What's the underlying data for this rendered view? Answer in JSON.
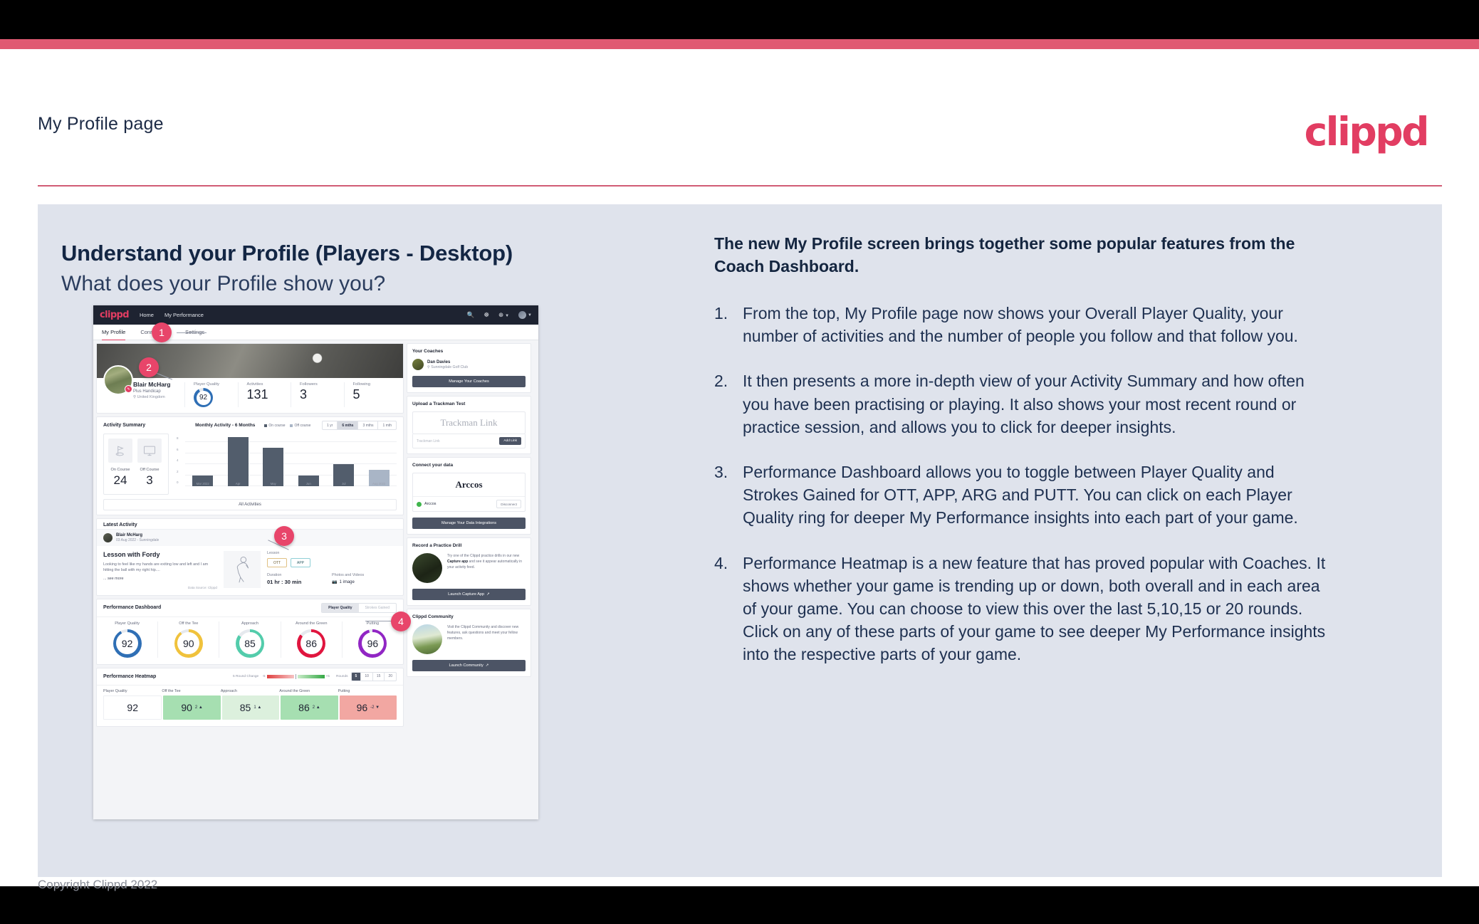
{
  "slide": {
    "header_title": "My Profile page",
    "brand_logo": "clippd",
    "heading_main": "Understand your Profile (Players - Desktop)",
    "heading_sub": "What does your Profile show you?",
    "footer": "Copyright Clippd 2022",
    "accent_pink": "#e23d62",
    "panel_bg": "#dfe3ec"
  },
  "text_column": {
    "lead": "The new My Profile screen brings together some popular features from the Coach Dashboard.",
    "items": [
      {
        "num": "1.",
        "text": "From the top, My Profile page now shows your Overall Player Quality, your number of activities and the number of people you follow and that follow you."
      },
      {
        "num": "2.",
        "text": "It then presents a more in-depth view of your Activity Summary and how often you have been practising or playing. It also shows your most recent round or practice session, and allows you to click for deeper insights."
      },
      {
        "num": "3.",
        "text": "Performance Dashboard allows you to toggle between Player Quality and Strokes Gained for OTT, APP, ARG and PUTT. You can click on each Player Quality ring for deeper My Performance insights into each part of your game."
      },
      {
        "num": "4.",
        "text": "Performance Heatmap is a new feature that has proved popular with Coaches. It shows whether your game is trending up or down, both overall and in each area of your game. You can choose to view this over the last 5,10,15 or 20 rounds. Click on any of these parts of your game to see deeper My Performance insights into the respective parts of your game."
      }
    ]
  },
  "callouts": [
    {
      "num": "1"
    },
    {
      "num": "2"
    },
    {
      "num": "3"
    },
    {
      "num": "4"
    }
  ],
  "app": {
    "nav": {
      "logo": "clippd",
      "links": [
        "Home",
        "My Performance"
      ],
      "icons": [
        "search-icon",
        "community-icon",
        "add-circle-icon",
        "avatar-icon"
      ]
    },
    "tabs": [
      {
        "label": "My Profile",
        "active": true
      },
      {
        "label": "Connections",
        "active": false
      },
      {
        "label": "Settings",
        "active": false
      }
    ],
    "profile": {
      "name": "Blair McHarg",
      "handicap": "Plus Handicap",
      "location": "United Kingdom",
      "stats": [
        {
          "label": "Player Quality",
          "value": "92",
          "type": "ring",
          "color": "#2f6fb5"
        },
        {
          "label": "Activities",
          "value": "131",
          "type": "number"
        },
        {
          "label": "Followers",
          "value": "3",
          "type": "number"
        },
        {
          "label": "Following",
          "value": "5",
          "type": "number"
        }
      ]
    },
    "activity_summary": {
      "title": "Activity Summary",
      "chart_title": "Monthly Activity - 6 Months",
      "legend": [
        {
          "label": "On course",
          "color": "#525d6c"
        },
        {
          "label": "Off course",
          "color": "#a9b5c6"
        }
      ],
      "ranges": [
        {
          "label": "1 yr",
          "active": false
        },
        {
          "label": "6 mths",
          "active": true
        },
        {
          "label": "3 mths",
          "active": false
        },
        {
          "label": "1 mth",
          "active": false
        }
      ],
      "counters": [
        {
          "label": "On Course",
          "value": "24",
          "icon": "golf-flag-icon"
        },
        {
          "label": "Off Course",
          "value": "3",
          "icon": "monitor-icon"
        }
      ],
      "all_activities": "All Activities"
    },
    "latest_activity": {
      "section_title": "Latest Activity",
      "user": "Blair McHarg",
      "date": "03 Aug 2022 - Sunningdale",
      "title": "Lesson with Fordy",
      "description": "Looking to feel like my hands are exiting low and left and I am hitting the ball with my right hip....",
      "see_more": "... see more",
      "source": "Data Source: Clippd",
      "type_label": "Lesson",
      "tags": [
        "OTT",
        "APP"
      ],
      "duration_label": "Duration",
      "duration_value": "01 hr : 30 min",
      "media_label": "Photos and Videos",
      "media_value": "1 image"
    },
    "performance_dashboard": {
      "title": "Performance Dashboard",
      "toggle": [
        {
          "label": "Player Quality",
          "active": true
        },
        {
          "label": "Strokes Gained",
          "active": false
        }
      ],
      "rings": [
        {
          "label": "Player Quality",
          "value": "92",
          "color": "#2f6fb5"
        },
        {
          "label": "Off the Tee",
          "value": "90",
          "color": "#f0c23c"
        },
        {
          "label": "Approach",
          "value": "85",
          "color": "#53ccab"
        },
        {
          "label": "Around the Green",
          "value": "86",
          "color": "#e0153e"
        },
        {
          "label": "Putting",
          "value": "96",
          "color": "#9126c4"
        }
      ]
    },
    "performance_heatmap": {
      "title": "Performance Heatmap",
      "scale_label": "5 Round Change",
      "scale_min": "-5",
      "scale_max": "+5",
      "rounds_label": "Rounds",
      "rounds": [
        {
          "label": "5",
          "active": true
        },
        {
          "label": "10",
          "active": false
        },
        {
          "label": "15",
          "active": false
        },
        {
          "label": "20",
          "active": false
        }
      ],
      "cells": [
        {
          "label": "Player Quality",
          "value": "92",
          "delta": "",
          "bg": "#ffffff"
        },
        {
          "label": "Off the Tee",
          "value": "90",
          "delta": "2 ▲",
          "bg": "#a6dfb1"
        },
        {
          "label": "Approach",
          "value": "85",
          "delta": "1 ▲",
          "bg": "#dcf0dd"
        },
        {
          "label": "Around the Green",
          "value": "86",
          "delta": "2 ▲",
          "bg": "#a6dfb1"
        },
        {
          "label": "Putting",
          "value": "96",
          "delta": "-2 ▼",
          "bg": "#f2a7a2"
        }
      ]
    },
    "sidebar": {
      "coaches": {
        "title": "Your Coaches",
        "coach_name": "Dan Davies",
        "coach_club": "Sunningdale Golf Club",
        "button": "Manage Your Coaches"
      },
      "trackman": {
        "title": "Upload a Trackman Test",
        "brand": "Trackman Link",
        "placeholder": "Trackman Link",
        "button": "Add Link"
      },
      "connect": {
        "title": "Connect your data",
        "brand": "Arccos",
        "item_name": "Arccos",
        "disconnect": "Disconnect",
        "button": "Manage Your Data Integrations"
      },
      "drill": {
        "title": "Record a Practice Drill",
        "text_1": "Try one of the Clippd practice drills in our new ",
        "text_bold": "Capture app",
        "text_2": " and see it appear automatically in your activity feed.",
        "button": "Launch Capture App"
      },
      "community": {
        "title": "Clippd Community",
        "text": "Visit the Clippd Community and discover new features, ask questions and meet your fellow members.",
        "button": "Launch Community"
      }
    }
  },
  "chart_data": {
    "type": "bar",
    "title": "Monthly Activity - 6 Months",
    "categories": [
      "Mar 2022",
      "Apr",
      "May",
      "Jun",
      "Jul",
      "Aug 2022"
    ],
    "values": [
      2,
      9,
      7,
      2,
      4,
      3
    ],
    "bar_types": [
      "on",
      "on",
      "on",
      "on",
      "on",
      "off"
    ],
    "series": [
      {
        "name": "On course",
        "values": [
          2,
          9,
          7,
          2,
          4,
          0
        ],
        "color": "#525d6c"
      },
      {
        "name": "Off course",
        "values": [
          0,
          0,
          0,
          0,
          0,
          3
        ],
        "color": "#a9b5c6"
      }
    ],
    "yticks": [
      0,
      2,
      4,
      6,
      8
    ],
    "ylim": [
      0,
      9.6
    ],
    "xlabel": "",
    "ylabel": "",
    "grid": true,
    "legend_position": "top"
  }
}
